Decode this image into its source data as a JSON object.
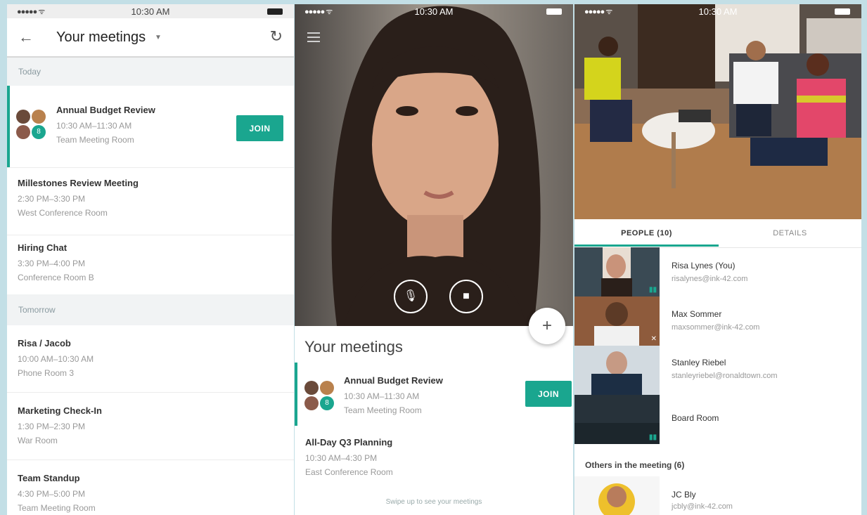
{
  "status": {
    "signal": "●●●●● ᯤ",
    "time": "10:30 AM"
  },
  "screen1": {
    "title": "Your meetings",
    "sections": {
      "today": "Today",
      "tomorrow": "Tomorrow"
    },
    "join_label": "JOIN",
    "today": [
      {
        "title": "Annual Budget Review",
        "time": "10:30 AM–11:30 AM",
        "room": "Team Meeting Room"
      },
      {
        "title": "Millestones Review Meeting",
        "time": "2:30 PM–3:30 PM",
        "room": "West Conference Room"
      },
      {
        "title": "Hiring Chat",
        "time": "3:30 PM–4:00 PM",
        "room": "Conference Room B"
      }
    ],
    "tomorrow": [
      {
        "title": "Risa / Jacob",
        "time": "10:00 AM–10:30 AM",
        "room": "Phone Room 3"
      },
      {
        "title": "Marketing Check-In",
        "time": "1:30 PM–2:30 PM",
        "room": "War Room"
      },
      {
        "title": "Team Standup",
        "time": "4:30 PM–5:00 PM",
        "room": "Team Meeting Room"
      }
    ]
  },
  "screen2": {
    "heading": "Your meetings",
    "join_label": "JOIN",
    "fab": "+",
    "meetings": [
      {
        "title": "Annual Budget Review",
        "time": "10:30 AM–11:30 AM",
        "room": "Team Meeting Room"
      },
      {
        "title": "All-Day Q3 Planning",
        "time": "10:30 AM–4:30 PM",
        "room": "East Conference Room"
      }
    ],
    "hint": "Swipe up to see your meetings"
  },
  "screen3": {
    "tabs": {
      "people": "PEOPLE (10)",
      "details": "DETAILS"
    },
    "people": [
      {
        "name": "Risa Lynes (You)",
        "email": "risalynes@ink-42.com"
      },
      {
        "name": "Max Sommer",
        "email": "maxsommer@ink-42.com"
      },
      {
        "name": "Stanley Riebel",
        "email": "stanleyriebel@ronaldtown.com"
      },
      {
        "name": "Board Room"
      }
    ],
    "others_heading": "Others in the meeting  (6)",
    "others": [
      {
        "name": "JC Bly",
        "email": "jcbly@ink-42.com"
      }
    ]
  },
  "colors": {
    "accent": "#1aa68f",
    "backdrop": "#c3dfe6"
  }
}
